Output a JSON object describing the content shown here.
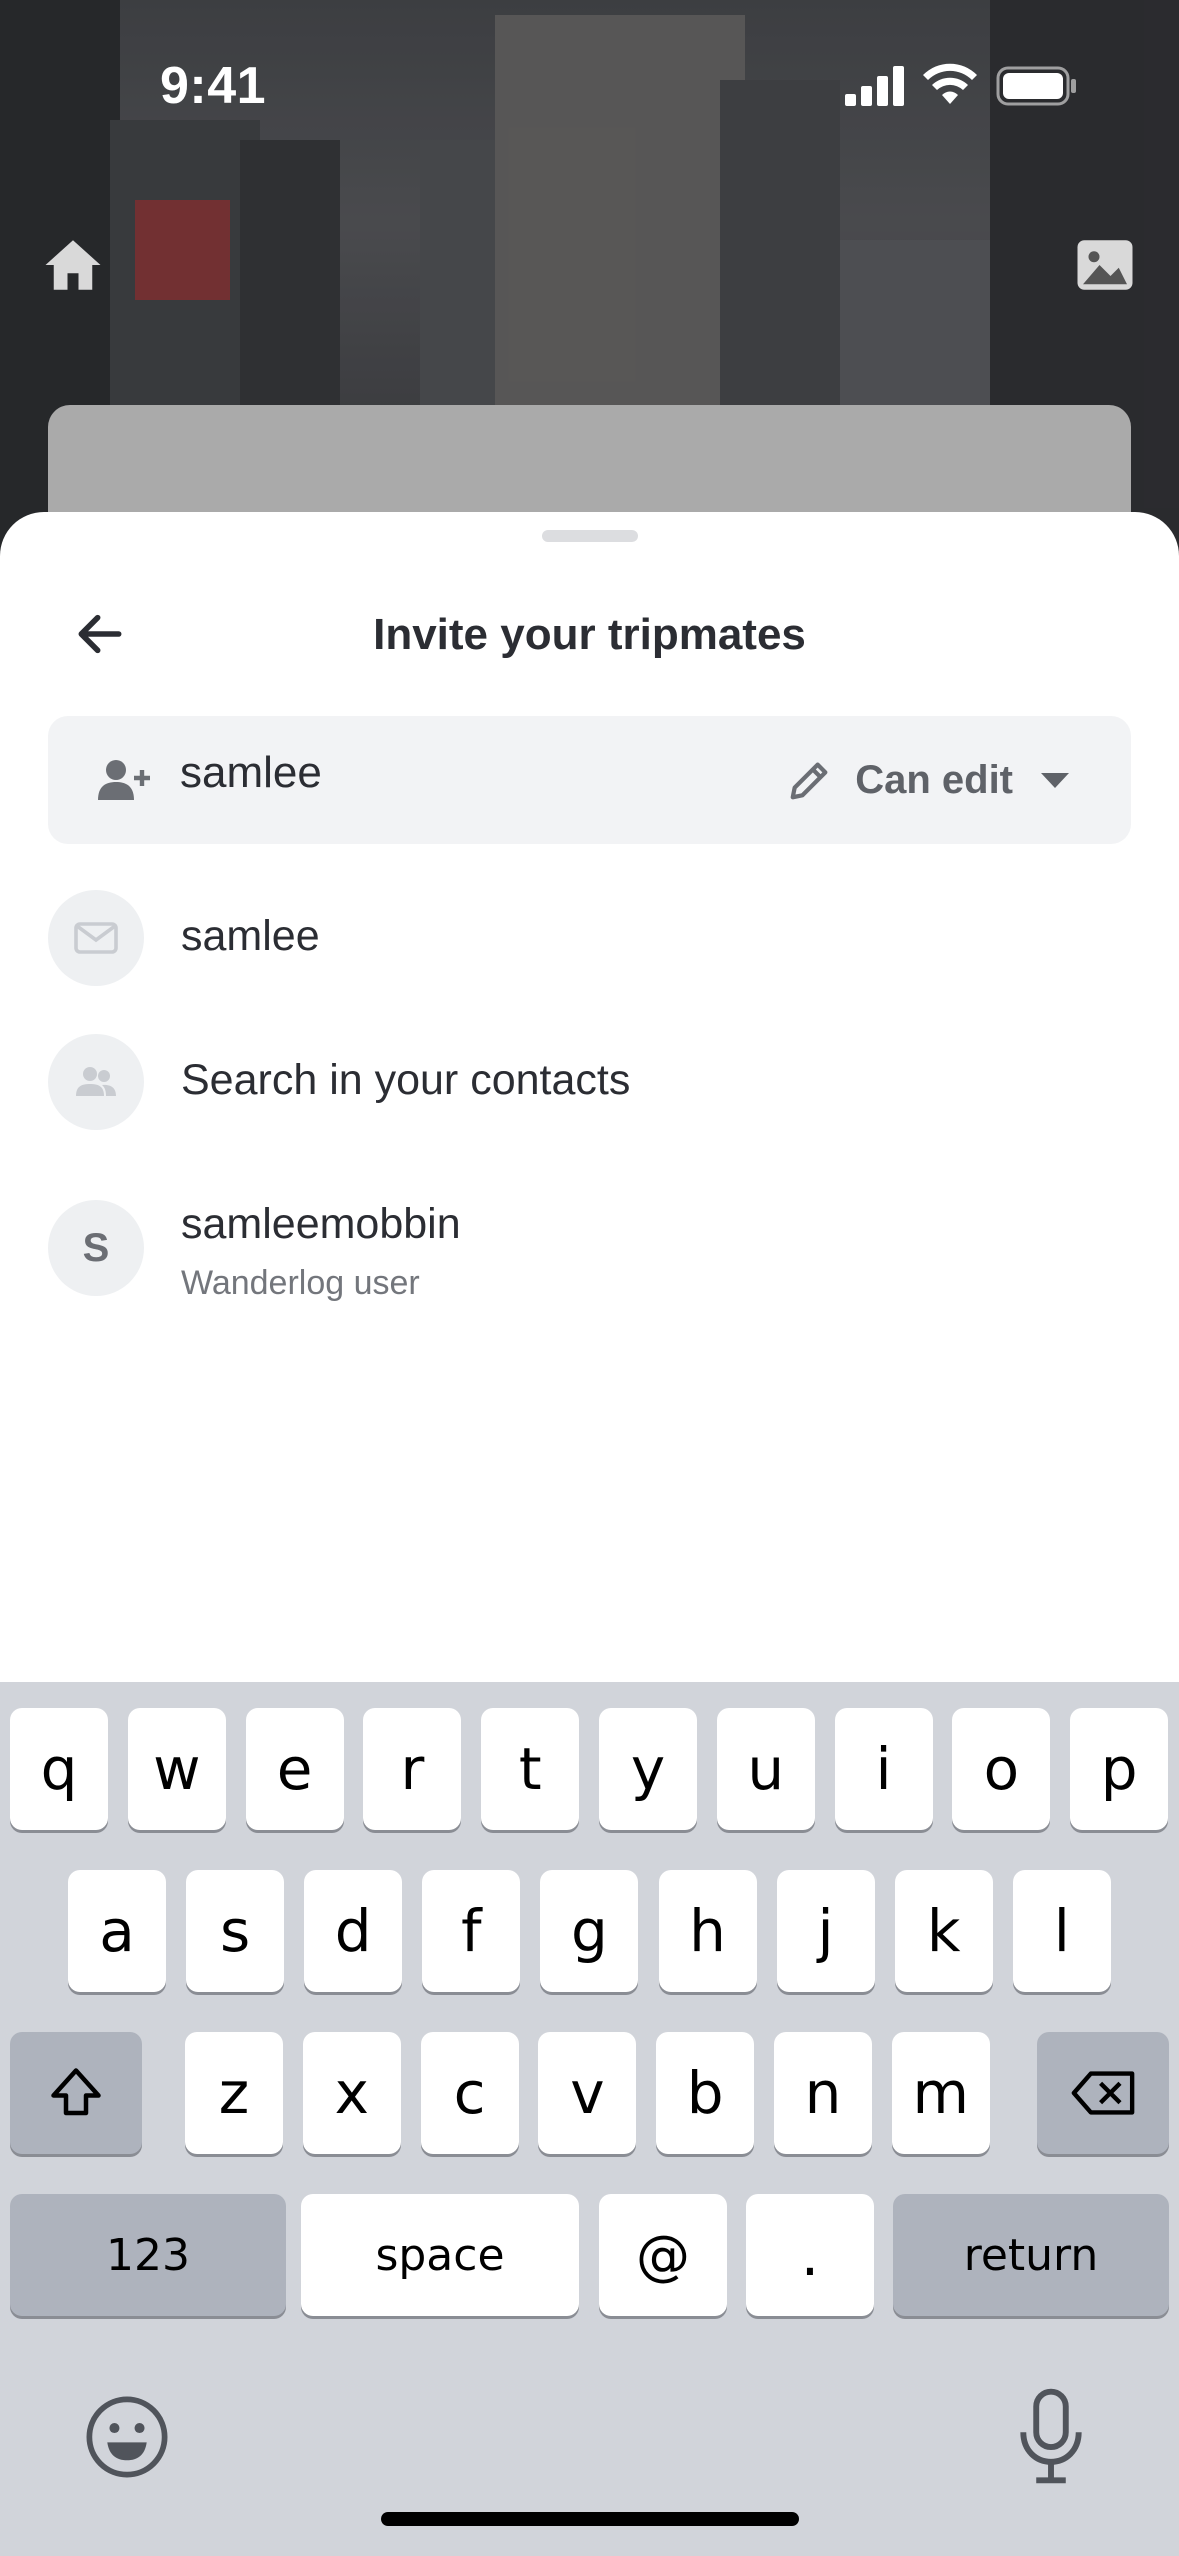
{
  "status_bar": {
    "time": "9:41"
  },
  "sheet": {
    "title": "Invite your tripmates",
    "invite": {
      "value": "samlee",
      "permission": "Can edit"
    },
    "suggestions": [
      {
        "icon": "mail-icon",
        "label": "samlee"
      },
      {
        "icon": "contacts-icon",
        "label": "Search in your contacts"
      },
      {
        "icon": "avatar",
        "initial": "S",
        "label": "samleemobbin",
        "sublabel": "Wanderlog user"
      }
    ]
  },
  "keyboard": {
    "row1": [
      "q",
      "w",
      "e",
      "r",
      "t",
      "y",
      "u",
      "i",
      "o",
      "p"
    ],
    "row2": [
      "a",
      "s",
      "d",
      "f",
      "g",
      "h",
      "j",
      "k",
      "l"
    ],
    "row3": [
      "z",
      "x",
      "c",
      "v",
      "b",
      "n",
      "m"
    ],
    "numbers_label": "123",
    "space_label": "space",
    "at_label": "@",
    "dot_label": ".",
    "return_label": "return"
  },
  "colors": {
    "sheet_bg": "#ffffff",
    "field_bg": "#f2f3f5",
    "keyboard_bg": "#d1d4da",
    "text_primary": "#2b2d33",
    "text_secondary": "#73767c"
  }
}
